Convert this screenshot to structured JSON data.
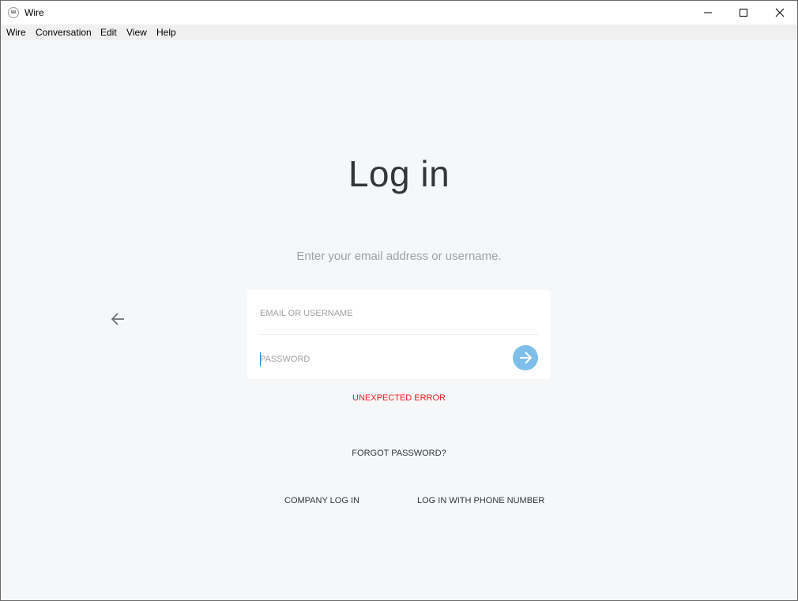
{
  "window": {
    "title": "Wire",
    "app_icon_glyph": "ɯ"
  },
  "menu": {
    "items": [
      "Wire",
      "Conversation",
      "Edit",
      "View",
      "Help"
    ]
  },
  "login": {
    "title": "Log in",
    "subtitle": "Enter your email address or username.",
    "email_placeholder": "EMAIL OR USERNAME",
    "password_placeholder": "PASSWORD",
    "error": "UNEXPECTED ERROR",
    "forgot_password": "FORGOT PASSWORD?",
    "company_login": "COMPANY LOG IN",
    "phone_login": "LOG IN WITH PHONE NUMBER"
  },
  "icons": {
    "back": "arrow-left-icon",
    "submit": "arrow-right-icon",
    "minimize": "minimize-icon",
    "maximize": "maximize-icon",
    "close": "close-icon"
  },
  "colors": {
    "background": "#f6f7f9",
    "accent": "#7dbfe8",
    "error": "#e6201b",
    "text": "#33373a",
    "placeholder": "#9fa1a7"
  }
}
